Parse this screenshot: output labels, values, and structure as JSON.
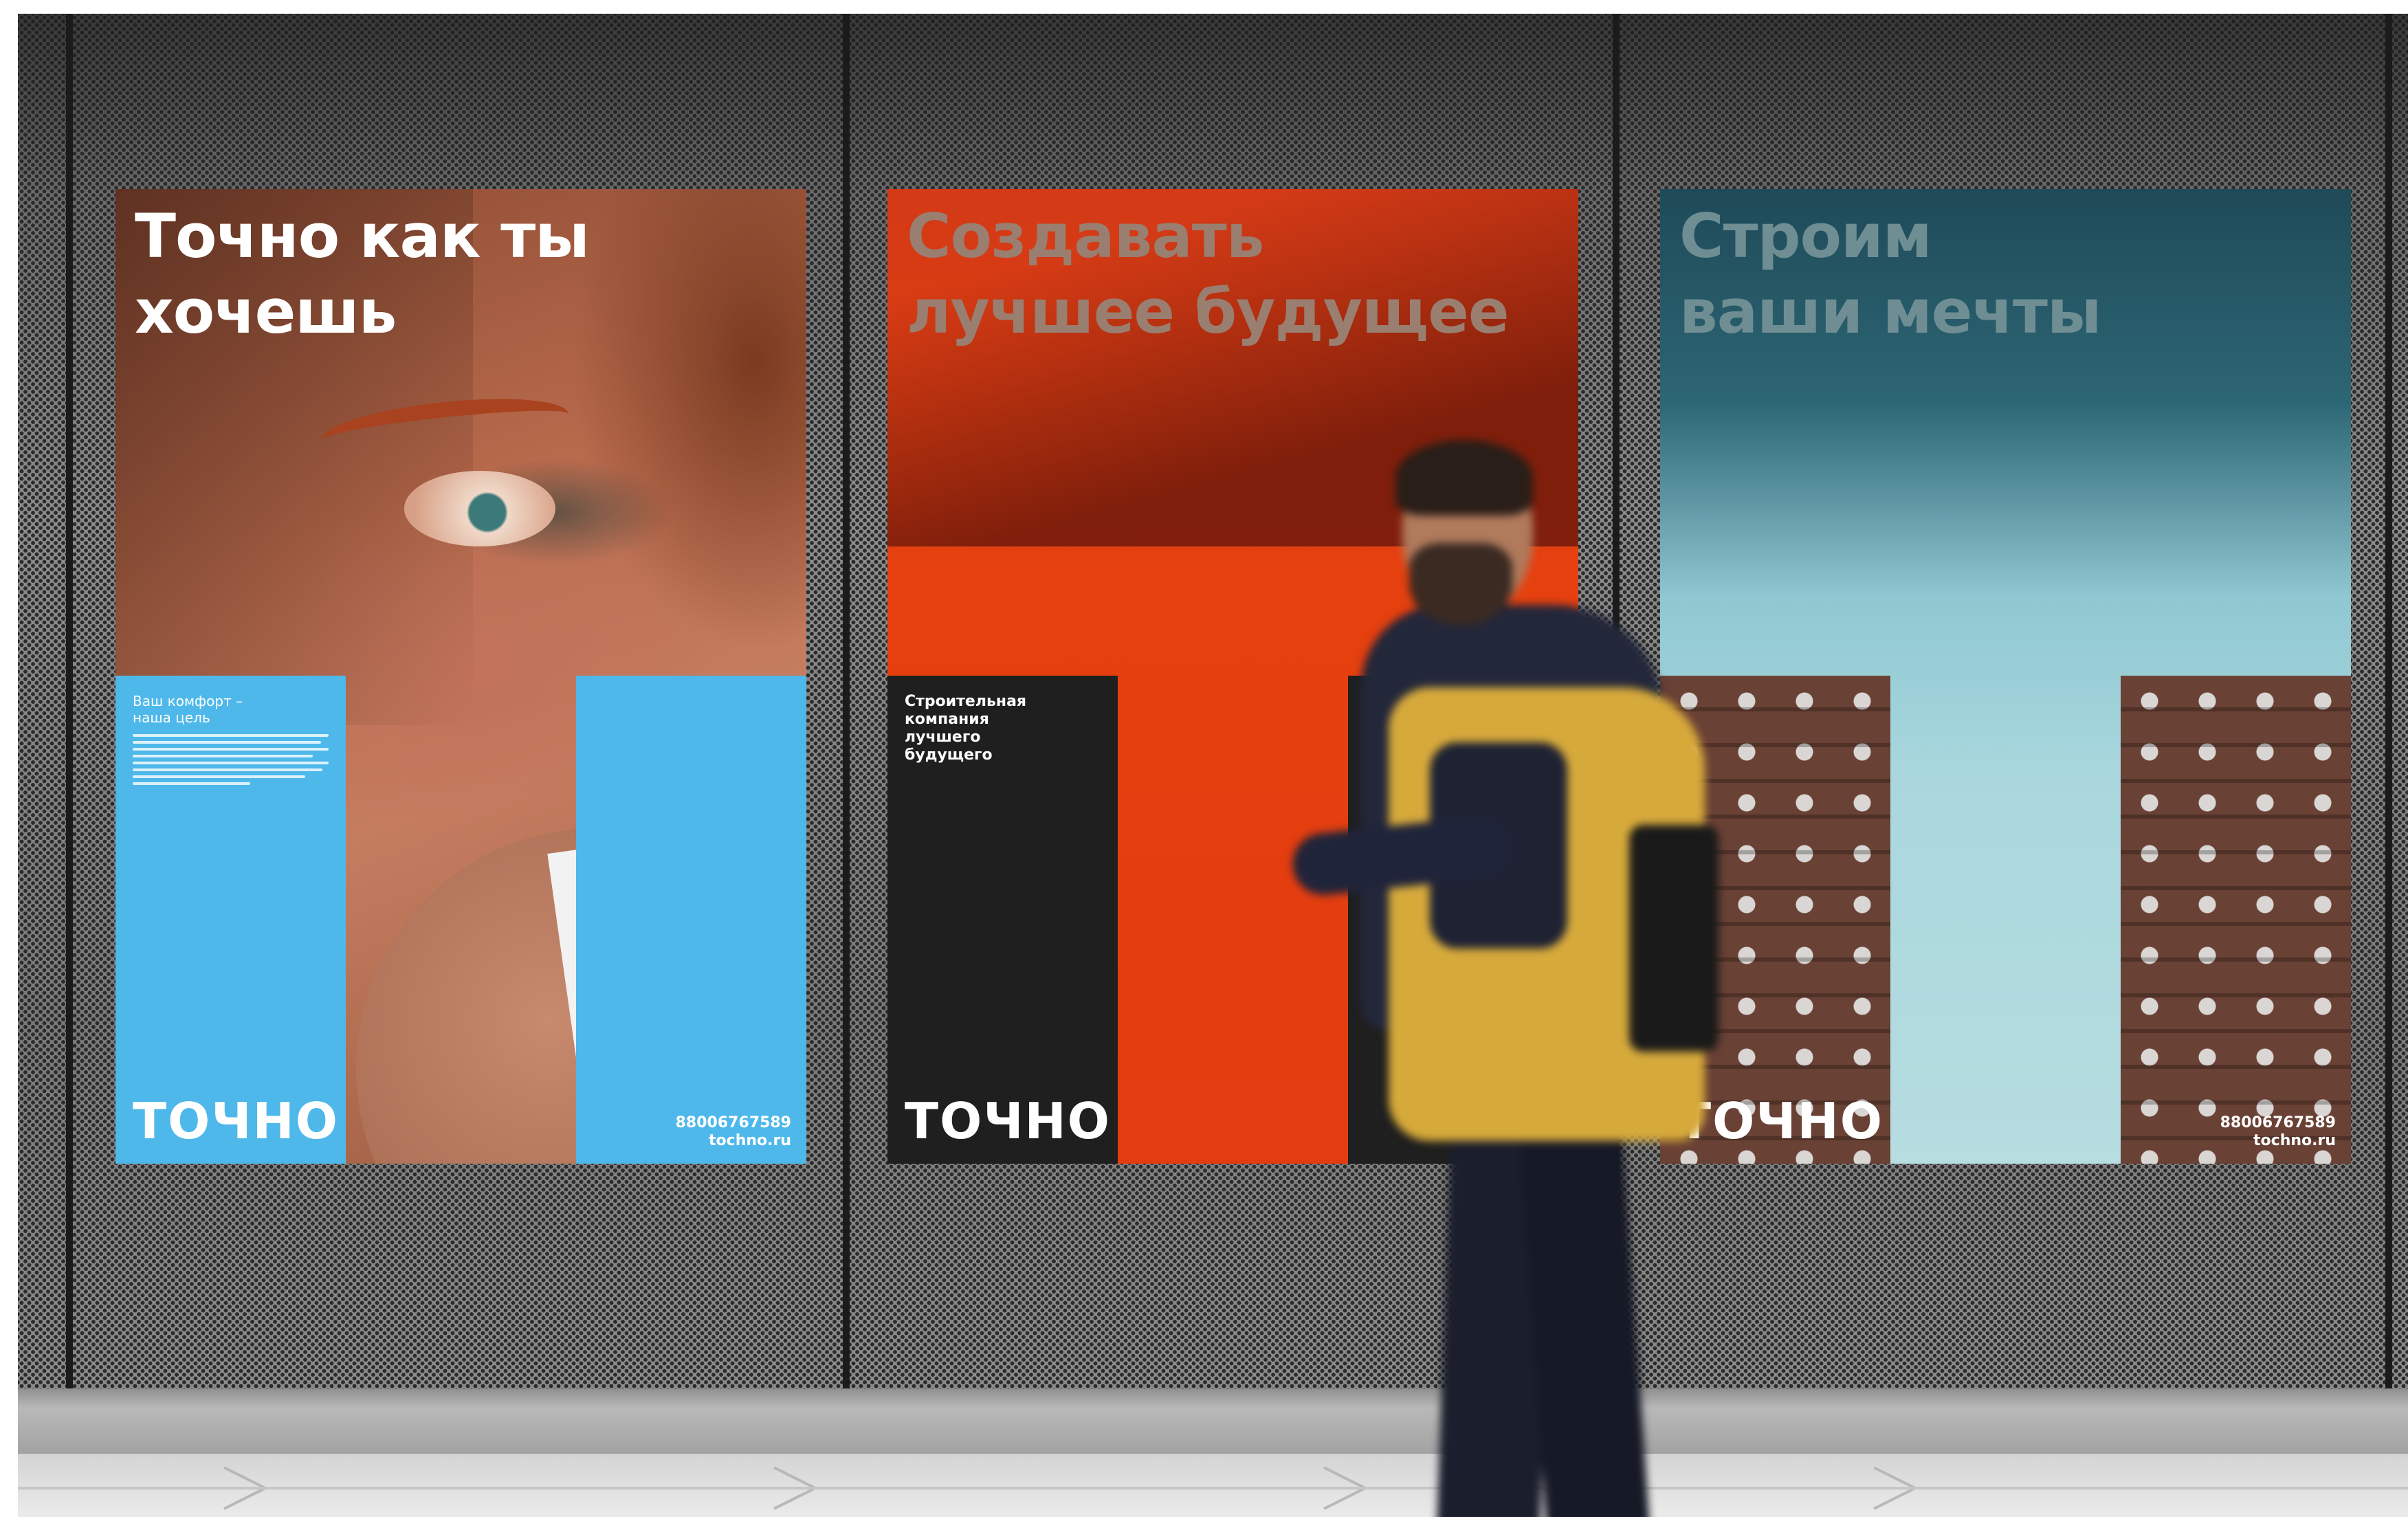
{
  "posters": [
    {
      "title": "Точно как ты\nхочешь",
      "tagline": "Ваш комфорт –\nнаша цель",
      "logo": "ТОЧНО",
      "phone": "88006767589",
      "website": "tochno.ru",
      "accent_color": "#4eb8ea"
    },
    {
      "title": "Создавать\nлучшее будущее",
      "tagline": "Строительная\nкомпания\nлучшего\nбудущего",
      "logo": "ТОЧНО",
      "accent_color": "#e6400f"
    },
    {
      "title": "Строим\nваши мечты",
      "logo": "ТОЧНО",
      "phone": "88006767589",
      "website": "tochno.ru",
      "accent_color": "#a9d7dd"
    }
  ]
}
